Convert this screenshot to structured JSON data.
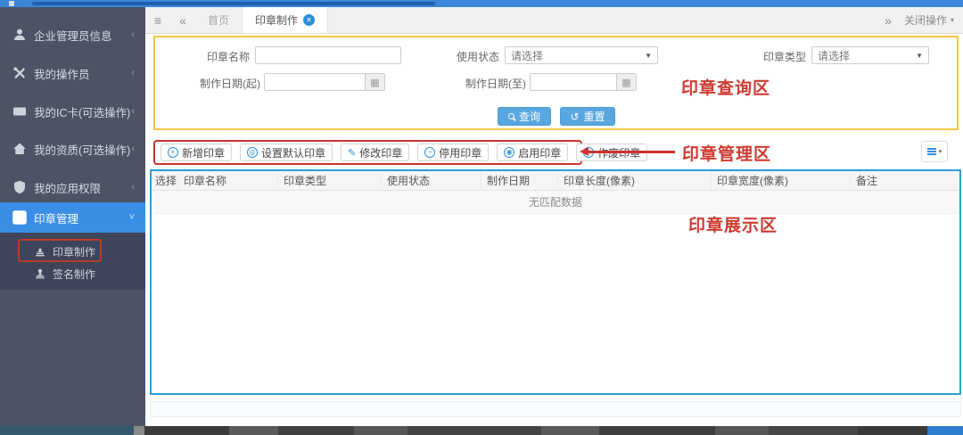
{
  "colors": {
    "topbar": "#3a87d9",
    "sidebar_bg": "#4b5364",
    "sidebar_active": "#3a8ee6",
    "annotation_red": "#cd3a30",
    "query_border_yellow": "#f5c445",
    "table_border_blue": "#2d9ed7",
    "primary_button_blue": "#58a7e0",
    "toolbar_icon_blue": "#2f8fdc"
  },
  "sidebar": {
    "items": [
      {
        "label": "企业管理员信息",
        "icon": "user-icon",
        "chevron": "‹"
      },
      {
        "label": "我的操作员",
        "icon": "tools-icon",
        "chevron": "‹"
      },
      {
        "label": "我的IC卡(可选操作)",
        "icon": "ic-card-icon",
        "chevron": "‹"
      },
      {
        "label": "我的资质(可选操作)",
        "icon": "home-icon",
        "chevron": "‹"
      },
      {
        "label": "我的应用权限",
        "icon": "shield-icon",
        "chevron": "‹"
      },
      {
        "label": "印章管理",
        "icon": "seal-manage-icon",
        "chevron": "˅",
        "active": true
      }
    ],
    "subitems": [
      {
        "label": "印章制作",
        "icon": "stamp-icon",
        "annotated": true
      },
      {
        "label": "签名制作",
        "icon": "signature-stamp-icon"
      }
    ]
  },
  "tabbar": {
    "menu_icon": "≡",
    "back_icon": "«",
    "forward_icon": "»",
    "tabs": [
      {
        "label": "首页"
      },
      {
        "label": "印章制作",
        "active": true,
        "close_glyph": "✕"
      }
    ],
    "close_ops_label": "关闭操作",
    "close_ops_caret": "▾"
  },
  "query": {
    "seal_name_label": "印章名称",
    "usage_status_label": "使用状态",
    "seal_type_label": "印章类型",
    "date_from_label": "制作日期(起)",
    "date_to_label": "制作日期(至)",
    "select_placeholder": "请选择",
    "select_caret": "▼",
    "calendar_glyph": "▦",
    "search_label": "查询",
    "reset_label": "重置",
    "reset_glyph": "↺",
    "annotation": "印章查询区"
  },
  "toolbar": {
    "buttons": [
      {
        "label": "新增印章",
        "icon": "add-circle-icon",
        "glyph": "+"
      },
      {
        "label": "设置默认印章",
        "icon": "set-default-circle-icon",
        "glyph": "◎"
      },
      {
        "label": "修改印章",
        "icon": "edit-pencil-icon",
        "glyph": "✎"
      },
      {
        "label": "停用印章",
        "icon": "disable-circle-icon",
        "glyph": "−"
      },
      {
        "label": "启用印章",
        "icon": "enable-circle-icon",
        "glyph": "◉"
      },
      {
        "label": "作废印章",
        "icon": "void-circle-icon",
        "glyph": "✕"
      }
    ],
    "annotation": "印章管理区",
    "options_caret": "▾"
  },
  "table": {
    "columns": [
      "选择",
      "印章名称",
      "印章类型",
      "使用状态",
      "制作日期",
      "印章长度(像素)",
      "印章宽度(像素)",
      "备注"
    ],
    "empty_text": "无匹配数据",
    "annotation": "印章展示区"
  }
}
